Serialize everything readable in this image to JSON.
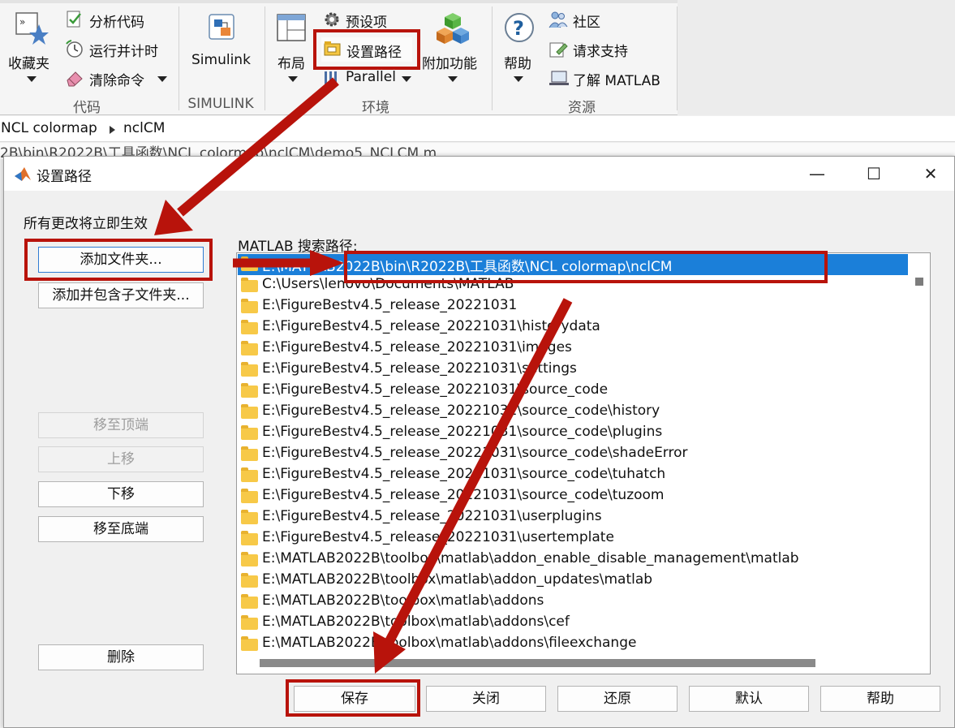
{
  "ribbon": {
    "favorites": "收藏夹",
    "analyze_code": "分析代码",
    "run_and_time": "运行并计时",
    "clear_commands": "清除命令",
    "group_code": "代码",
    "simulink": "Simulink",
    "group_simulink": "SIMULINK",
    "layout": "布局",
    "preferences": "预设项",
    "set_path": "设置路径",
    "parallel": "Parallel",
    "addons": "附加功能",
    "group_environment": "环境",
    "help": "帮助",
    "community": "社区",
    "request_support": "请求支持",
    "learn_matlab": "了解 MATLAB",
    "group_resources": "资源"
  },
  "breadcrumb": {
    "part1": "NCL colormap",
    "part2": "nclCM"
  },
  "file_path_line": "2B\\bin\\R2022B\\工具函数\\NCL colormap\\nclCM\\demo5_NCLCM.m",
  "dialog": {
    "title": "设置路径",
    "controls": {
      "minimize": "—",
      "maximize": "☐",
      "close": "✕"
    },
    "note": "所有更改将立即生效",
    "search_path_label": "MATLAB 搜索路径:",
    "buttons": {
      "add_folder": "添加文件夹...",
      "add_with_subfolders": "添加并包含子文件夹...",
      "move_to_top": "移至顶端",
      "move_up": "上移",
      "move_down": "下移",
      "move_to_bottom": "移至底端",
      "remove": "删除",
      "save": "保存",
      "close": "关闭",
      "revert": "还原",
      "default": "默认",
      "help": "帮助"
    },
    "paths": [
      "E:\\MATLAB2022B\\bin\\R2022B\\工具函数\\NCL colormap\\nclCM",
      "C:\\Users\\lenovo\\Documents\\MATLAB",
      "E:\\FigureBestv4.5_release_20221031",
      "E:\\FigureBestv4.5_release_20221031\\historydata",
      "E:\\FigureBestv4.5_release_20221031\\images",
      "E:\\FigureBestv4.5_release_20221031\\settings",
      "E:\\FigureBestv4.5_release_20221031\\source_code",
      "E:\\FigureBestv4.5_release_20221031\\source_code\\history",
      "E:\\FigureBestv4.5_release_20221031\\source_code\\plugins",
      "E:\\FigureBestv4.5_release_20221031\\source_code\\shadeError",
      "E:\\FigureBestv4.5_release_20221031\\source_code\\tuhatch",
      "E:\\FigureBestv4.5_release_20221031\\source_code\\tuzoom",
      "E:\\FigureBestv4.5_release_20221031\\userplugins",
      "E:\\FigureBestv4.5_release_20221031\\usertemplate",
      "E:\\MATLAB2022B\\toolbox\\matlab\\addon_enable_disable_management\\matlab",
      "E:\\MATLAB2022B\\toolbox\\matlab\\addon_updates\\matlab",
      "E:\\MATLAB2022B\\toolbox\\matlab\\addons",
      "E:\\MATLAB2022B\\toolbox\\matlab\\addons\\cef",
      "E:\\MATLAB2022B\\toolbox\\matlab\\addons\\fileexchange"
    ]
  },
  "colors": {
    "annotation_red": "#b8130b",
    "selection_blue": "#1b7fd9"
  }
}
